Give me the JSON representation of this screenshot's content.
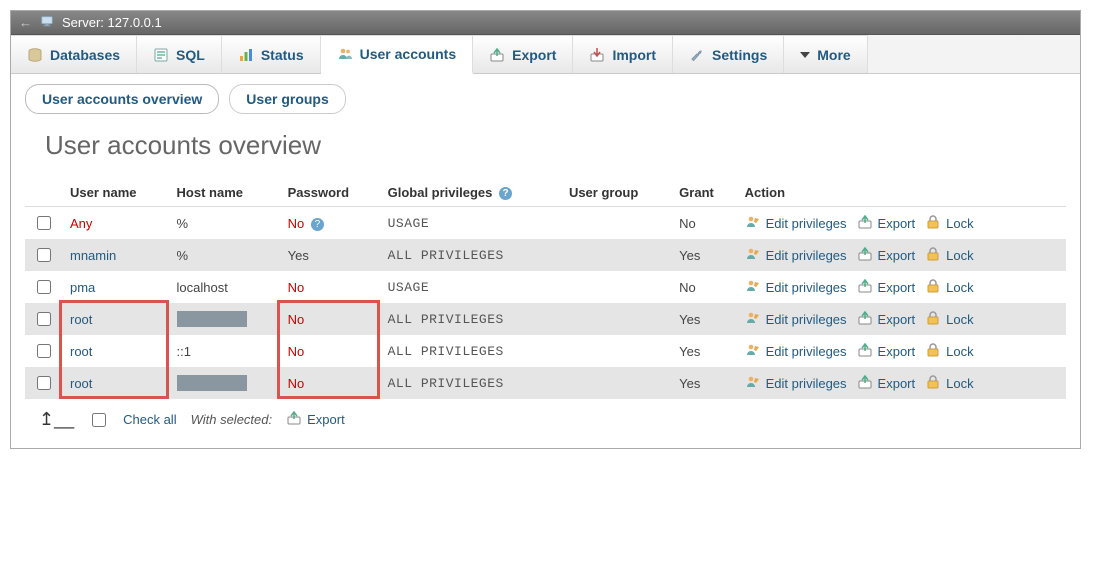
{
  "titlebar": {
    "server_label": "Server: 127.0.0.1"
  },
  "nav": {
    "tabs": [
      {
        "label": "Databases"
      },
      {
        "label": "SQL"
      },
      {
        "label": "Status"
      },
      {
        "label": "User accounts"
      },
      {
        "label": "Export"
      },
      {
        "label": "Import"
      },
      {
        "label": "Settings"
      },
      {
        "label": "More"
      }
    ],
    "active_index": 3
  },
  "subtabs": {
    "items": [
      {
        "label": "User accounts overview"
      },
      {
        "label": "User groups"
      }
    ],
    "active_index": 0
  },
  "page": {
    "heading": "User accounts overview"
  },
  "table": {
    "headers": {
      "username": "User name",
      "hostname": "Host name",
      "password": "Password",
      "privileges": "Global privileges",
      "usergroup": "User group",
      "grant": "Grant",
      "action": "Action"
    },
    "action_labels": {
      "edit": "Edit privileges",
      "export": "Export",
      "lock": "Lock"
    },
    "rows": [
      {
        "username": "Any",
        "username_class": "any",
        "hostname": "%",
        "password": "No",
        "pw_red": true,
        "pw_help": true,
        "privileges": "USAGE",
        "usergroup": "",
        "grant": "No"
      },
      {
        "username": "mnamin",
        "hostname": "%",
        "password": "Yes",
        "pw_red": false,
        "privileges": "ALL PRIVILEGES",
        "usergroup": "",
        "grant": "Yes"
      },
      {
        "username": "pma",
        "hostname": "localhost",
        "password": "No",
        "pw_red": true,
        "privileges": "USAGE",
        "usergroup": "",
        "grant": "No"
      },
      {
        "username": "root",
        "hostname_redacted": true,
        "password": "No",
        "pw_red": true,
        "privileges": "ALL PRIVILEGES",
        "usergroup": "",
        "grant": "Yes"
      },
      {
        "username": "root",
        "hostname": "::1",
        "password": "No",
        "pw_red": true,
        "privileges": "ALL PRIVILEGES",
        "usergroup": "",
        "grant": "Yes"
      },
      {
        "username": "root",
        "hostname_redacted": true,
        "password": "No",
        "pw_red": true,
        "privileges": "ALL PRIVILEGES",
        "usergroup": "",
        "grant": "Yes"
      }
    ]
  },
  "footer": {
    "check_all": "Check all",
    "with_selected": "With selected:",
    "export": "Export"
  }
}
